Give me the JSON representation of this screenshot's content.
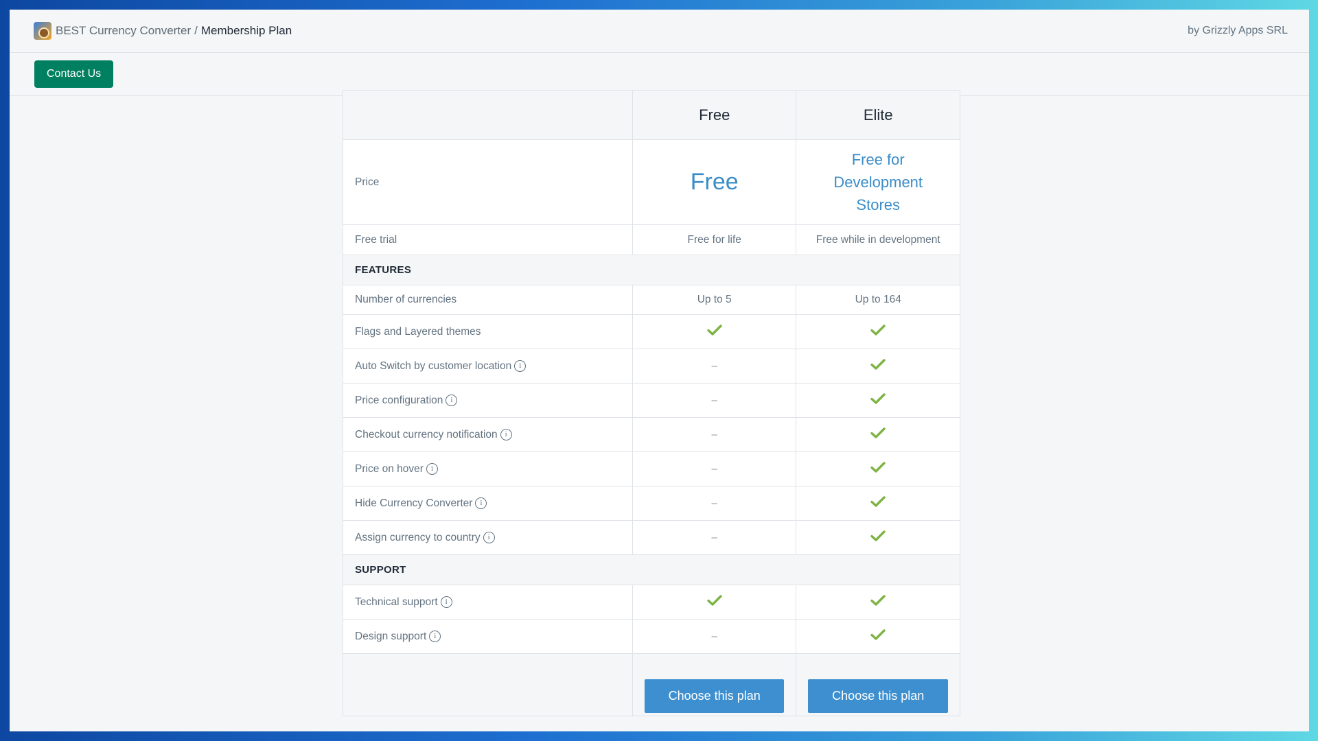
{
  "header": {
    "app_name": "BEST Currency Converter",
    "separator": "/",
    "page_title": "Membership Plan",
    "byline": "by Grizzly Apps SRL"
  },
  "actions": {
    "contact_label": "Contact Us"
  },
  "plans": {
    "free": {
      "name": "Free",
      "price": "Free",
      "trial": "Free for life",
      "button": "Choose this plan"
    },
    "elite": {
      "name": "Elite",
      "price_lines": [
        "Free for",
        "Development",
        "Stores"
      ],
      "trial": "Free while in development",
      "button": "Choose this plan"
    }
  },
  "rows": {
    "price_label": "Price",
    "trial_label": "Free trial"
  },
  "sections": {
    "features": "FEATURES",
    "support": "SUPPORT"
  },
  "features": [
    {
      "label": "Number of currencies",
      "free": "Up to 5",
      "elite": "Up to 164",
      "info": false
    },
    {
      "label": "Flags and Layered themes",
      "free": "check",
      "elite": "check",
      "info": false
    },
    {
      "label": "Auto Switch by customer location",
      "free": "–",
      "elite": "check",
      "info": true
    },
    {
      "label": "Price configuration",
      "free": "–",
      "elite": "check",
      "info": true
    },
    {
      "label": "Checkout currency notification",
      "free": "–",
      "elite": "check",
      "info": true
    },
    {
      "label": "Price on hover",
      "free": "–",
      "elite": "check",
      "info": true
    },
    {
      "label": "Hide Currency Converter",
      "free": "–",
      "elite": "check",
      "info": true
    },
    {
      "label": "Assign currency to country",
      "free": "–",
      "elite": "check",
      "info": true
    }
  ],
  "support": [
    {
      "label": "Technical support",
      "free": "check",
      "elite": "check",
      "info": true
    },
    {
      "label": "Design support",
      "free": "–",
      "elite": "check",
      "info": true
    }
  ],
  "icons": {
    "info": "i",
    "check": "check-icon"
  },
  "colors": {
    "primary_green": "#008060",
    "plan_blue": "#3a8dc8",
    "check_green": "#7cb342"
  }
}
